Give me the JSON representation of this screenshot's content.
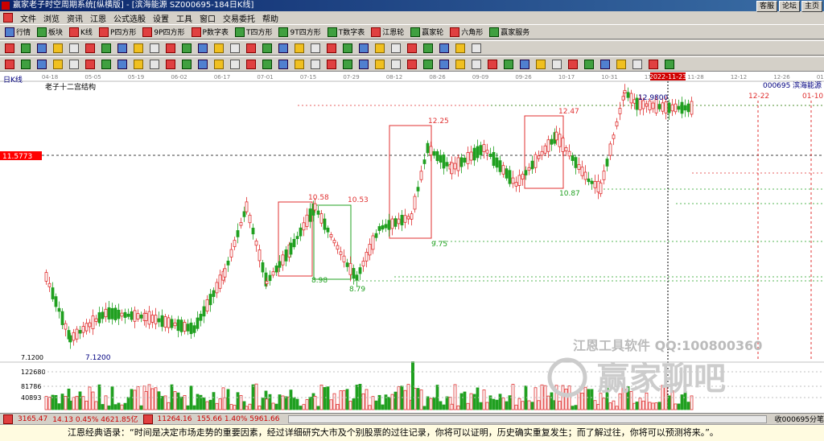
{
  "window": {
    "title": "赢家老子时空周期系统[纵横版] - [滨海能源  SZ000695-184日K线]",
    "buttons": [
      "客服",
      "论坛",
      "主页"
    ]
  },
  "menu": [
    "文件",
    "浏览",
    "资讯",
    "江恩",
    "公式选股",
    "设置",
    "工具",
    "窗口",
    "交易委托",
    "帮助"
  ],
  "toolbar1": [
    "行情",
    "板块",
    "K线",
    "P四方形",
    "9P四方形",
    "P数字表",
    "T四方形",
    "9T四方形",
    "T数字表",
    "江恩轮",
    "赢家轮",
    "六角形",
    "赢家服务"
  ],
  "chart": {
    "period_label": "日K线",
    "indicator_label": "老子十二宫结构",
    "stock_code": "000695",
    "stock_name": "滨海能源",
    "current_date_label": "2022-11-23",
    "watermark_line1": "江恩工具软件   QQ:100800360",
    "watermark_line2": "赢家聊吧",
    "price_marker": "11.5773",
    "low_price_axis_label": "7.1200",
    "volume_axis_labels": [
      "122680",
      "81786",
      "40893"
    ],
    "date_ticks": [
      "04-18",
      "05-05",
      "05-19",
      "06-02",
      "06-17",
      "07-01",
      "07-15",
      "07-29",
      "08-12",
      "08-26",
      "09-09",
      "09-26",
      "10-17",
      "10-31",
      "11-14",
      "11-28",
      "12-12",
      "12-26",
      "01-09"
    ],
    "future_dates": [
      "12-22",
      "01-10"
    ],
    "annotations": [
      "10.58",
      "10.53",
      "8.98",
      "8.79",
      "12.25",
      "9.75",
      "12.47",
      "10.87",
      "12.9800",
      "7.1200"
    ]
  },
  "status": {
    "index1": "3165.47",
    "index1_change": "14.13 0.45% 4621.85亿",
    "index2": "11264.16",
    "index2_change": "155.66 1.40% 5961.66",
    "right_text": "收000695分笔"
  },
  "quote": "江恩经典语录：“时间是决定市场走势的重要因素，经过详细研究大市及个别股票的过往记录，你将可以证明，历史确实重复发生；而了解过往，你将可以预测将来。”。",
  "colors": {
    "up": "#e03030",
    "down": "#20a020",
    "title_bg": "#0a246a"
  }
}
